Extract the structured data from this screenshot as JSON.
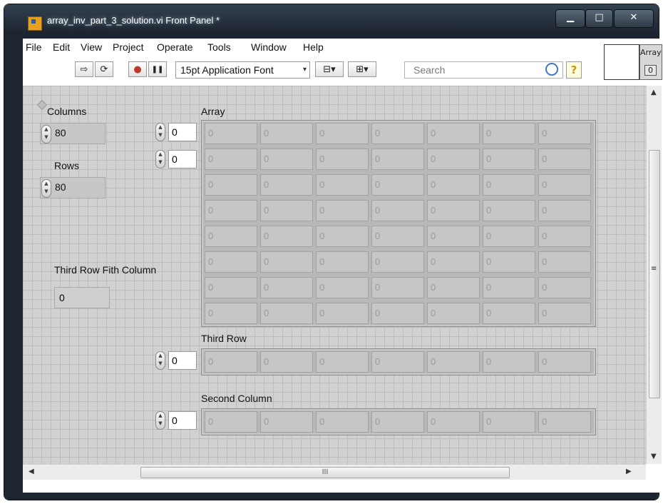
{
  "window": {
    "title": "array_inv_part_3_solution.vi Front Panel *",
    "minimize": "▁",
    "maximize": "□",
    "close": "✕"
  },
  "menu": [
    "File",
    "Edit",
    "View",
    "Project",
    "Operate",
    "Tools",
    "Window",
    "Help"
  ],
  "toolbar": {
    "run": "⇨",
    "run_continuous": "⟳",
    "abort": "●",
    "pause": "❚❚",
    "font": "15pt Application Font",
    "font_arrow": "▾",
    "align": "⊟▾",
    "distribute": "⊞▾",
    "search_placeholder": "Search",
    "help": "?"
  },
  "connector": {
    "label": "Array",
    "value": "0"
  },
  "panel": {
    "columns_label": "Columns",
    "columns_value": "80",
    "rows_label": "Rows",
    "rows_value": "80",
    "third_row_fifth_col_label": "Third Row Fith Column",
    "third_row_fifth_col_value": "0",
    "array_label": "Array",
    "array_index_row": "0",
    "array_index_col": "0",
    "third_row_label": "Third Row",
    "third_row_index": "0",
    "second_column_label": "Second Column",
    "second_column_index": "0",
    "array_rows": 8,
    "array_cols": 7,
    "cell_value": "0"
  },
  "scroll": {
    "hthumb": "III",
    "up": "▲",
    "down": "▼",
    "left": "◀",
    "right": "▶",
    "vgrip": "≡"
  }
}
